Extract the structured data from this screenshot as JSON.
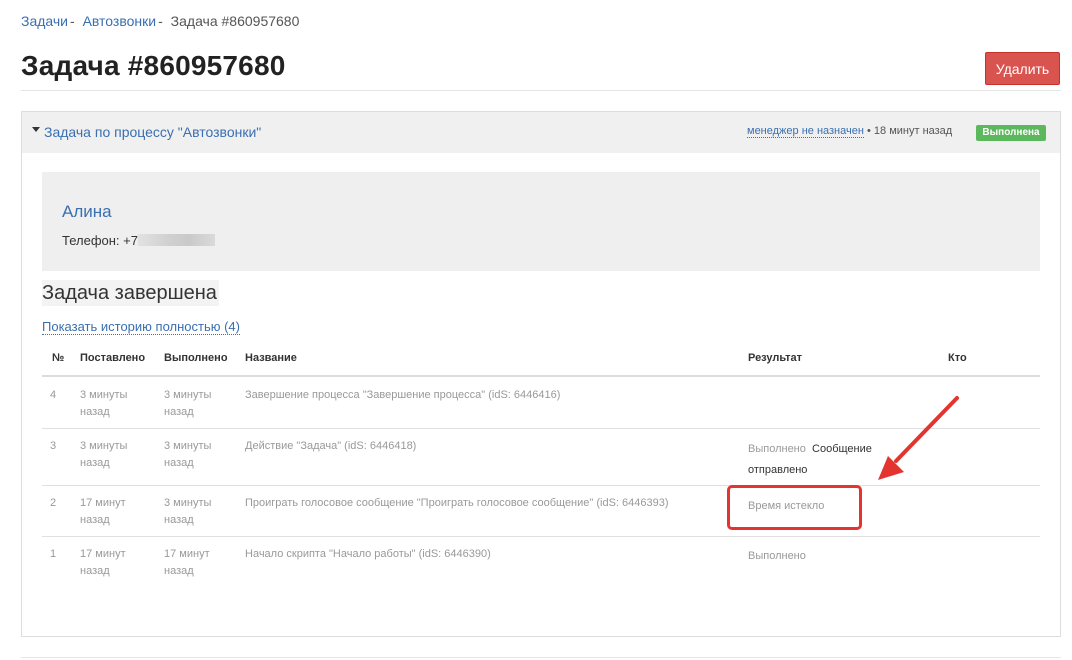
{
  "breadcrumb": {
    "items": [
      "Задачи",
      "Автозвонки"
    ],
    "separator": "-",
    "current": "Задача #860957680"
  },
  "page": {
    "title": "Задача #860957680"
  },
  "toolbar": {
    "delete_label": "Удалить"
  },
  "panel": {
    "title": "Задача по процессу \"Автозвонки\"",
    "manager": "менеджер не назначен",
    "time": "• 18 минут назад",
    "status": "Выполнена"
  },
  "contact": {
    "name": "Алина",
    "phone_prefix": "Телефон: +7"
  },
  "task_status": "Задача завершена",
  "history_link": "Показать историю полностью (4)",
  "table": {
    "headers": [
      "№",
      "Поставлено",
      "Выполнено",
      "Название",
      "Результат",
      "Кто"
    ],
    "rows": [
      {
        "num": "4",
        "set": "3 минуты назад",
        "done": "3 минуты назад",
        "name": "Завершение процесса \"Завершение процесса\" (idS: 6446416)",
        "result": "",
        "result_extra": "",
        "who": ""
      },
      {
        "num": "3",
        "set": "3 минуты назад",
        "done": "3 минуты назад",
        "name": "Действие \"Задача\" (idS: 6446418)",
        "result": "Выполнено",
        "result_extra": "Сообщение отправлено",
        "who": ""
      },
      {
        "num": "2",
        "set": "17 минут назад",
        "done": "3 минуты назад",
        "name": "Проиграть голосовое сообщение \"Проиграть голосовое сообщение\" (idS: 6446393)",
        "result": "Время истекло",
        "result_extra": "",
        "who": ""
      },
      {
        "num": "1",
        "set": "17 минут назад",
        "done": "17 минут назад",
        "name": "Начало скрипта \"Начало работы\" (idS: 6446390)",
        "result": "Выполнено",
        "result_extra": "",
        "who": ""
      }
    ]
  },
  "colors": {
    "link": "#3a6fb0",
    "danger": "#d9534f",
    "success": "#5cb85c",
    "annotation": "#e3342f"
  }
}
